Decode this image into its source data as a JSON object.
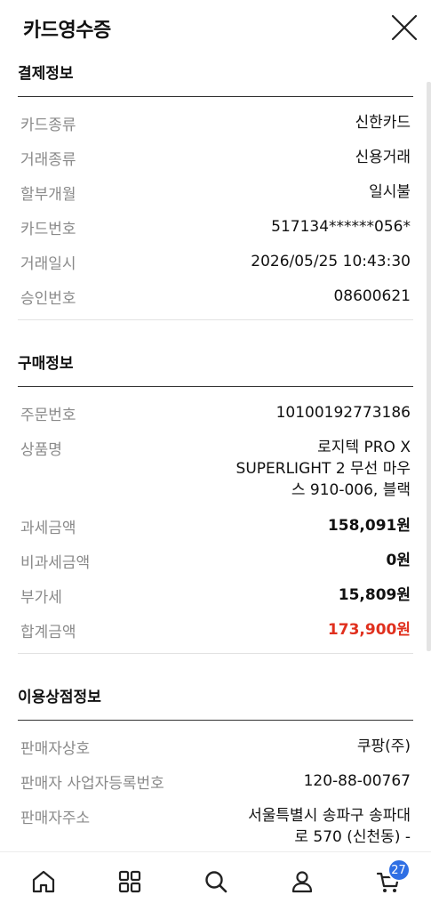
{
  "header": {
    "title": "카드영수증"
  },
  "payment": {
    "title": "결제정보",
    "rows": [
      {
        "label": "카드종류",
        "value": "신한카드"
      },
      {
        "label": "거래종류",
        "value": "신용거래"
      },
      {
        "label": "할부개월",
        "value": "일시불"
      },
      {
        "label": "카드번호",
        "value": "517134******056*"
      },
      {
        "label": "거래일시",
        "value": "2026/05/25 10:43:30"
      },
      {
        "label": "승인번호",
        "value": "08600621"
      }
    ]
  },
  "purchase": {
    "title": "구매정보",
    "order_label": "주문번호",
    "order_value": "10100192773186",
    "product_label": "상품명",
    "product_line1": "로지텍 PRO X",
    "product_line2": "SUPERLIGHT 2 무선 마우",
    "product_line3": "스 910-006, 블랙",
    "taxable_label": "과세금액",
    "taxable_value": "158,091원",
    "nontax_label": "비과세금액",
    "nontax_value": "0원",
    "vat_label": "부가세",
    "vat_value": "15,809원",
    "total_label": "합계금액",
    "total_value": "173,900원"
  },
  "merchant": {
    "title": "이용상점정보",
    "name_label": "판매자상호",
    "name_value": "쿠팡(주)",
    "biz_label": "판매자 사업자등록번호",
    "biz_value": "120-88-00767",
    "addr_label": "판매자주소",
    "addr_line1": "서울특별시 송파구 송파대",
    "addr_line2": "로 570 (신천동) -"
  },
  "nav": {
    "cart_badge": "27"
  },
  "colors": {
    "accent_red": "#e0301e",
    "badge_blue": "#2f6fe4"
  }
}
